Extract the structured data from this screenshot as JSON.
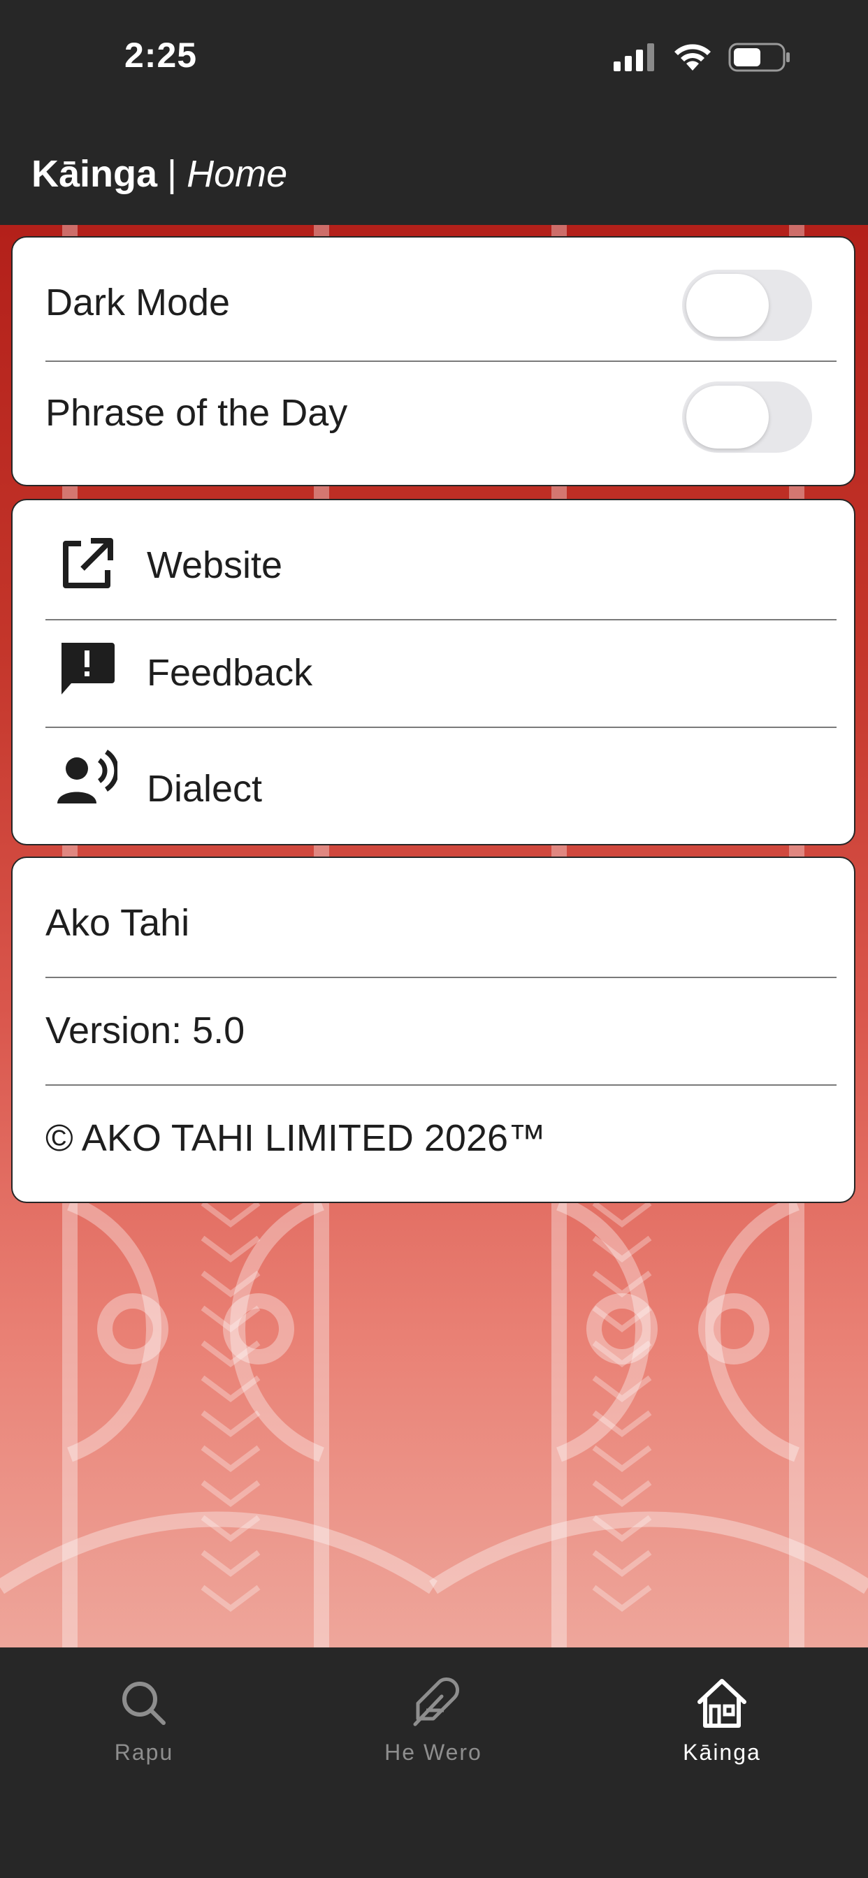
{
  "status_bar": {
    "time": "2:25",
    "icons": [
      "cellular-signal-icon",
      "wifi-icon",
      "battery-icon"
    ]
  },
  "header": {
    "app_name": "Kāinga",
    "separator": "|",
    "page_name": "Home"
  },
  "settings_card": {
    "items": [
      {
        "label": "Dark Mode",
        "toggle_on": false
      },
      {
        "label": "Phrase of the Day",
        "toggle_on": false
      }
    ]
  },
  "links_card": {
    "items": [
      {
        "label": "Website",
        "icon": "external-link-icon"
      },
      {
        "label": "Feedback",
        "icon": "feedback-icon"
      },
      {
        "label": "Dialect",
        "icon": "speaker-person-icon"
      }
    ]
  },
  "about_card": {
    "app_title": "Ako Tahi",
    "version": "Version: 5.0",
    "copyright": "© AKO TAHI LIMITED 2026™"
  },
  "tabbar": {
    "tabs": [
      {
        "label": "Rapu",
        "icon": "search-icon",
        "active": false
      },
      {
        "label": "He Wero",
        "icon": "feather-icon",
        "active": false
      },
      {
        "label": "Kāinga",
        "icon": "home-icon",
        "active": true
      }
    ]
  },
  "colors": {
    "chrome": "#272727",
    "pattern_red": "#b3201a",
    "pattern_pink": "#eea69b",
    "active_tab": "#ffffff",
    "inactive_tab": "#8e8e8e"
  }
}
